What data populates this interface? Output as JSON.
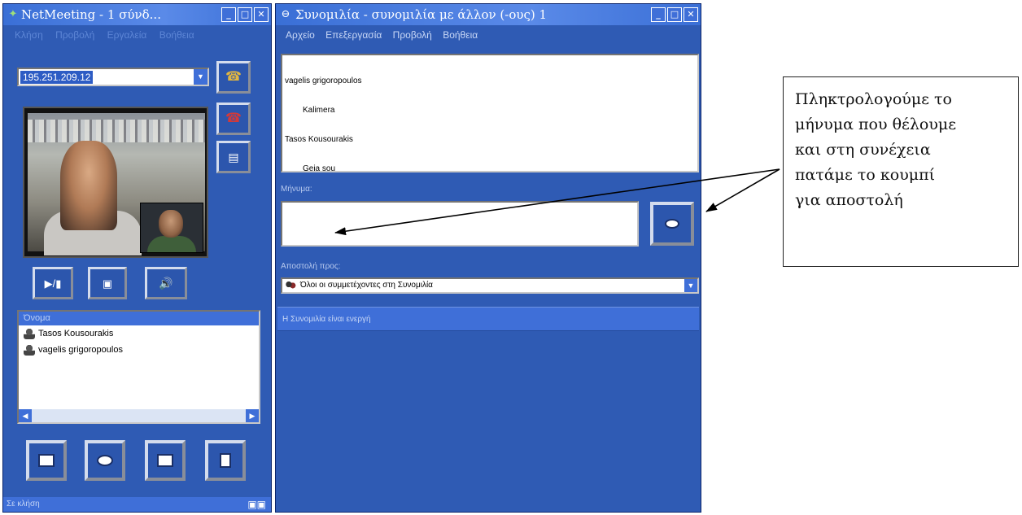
{
  "netmeeting": {
    "title": "NetMeeting - 1 σύνδ...",
    "menu": [
      "Κλήση",
      "Προβολή",
      "Εργαλεία",
      "Βοήθεια"
    ],
    "address_value": "195.251.209.12",
    "participants_header": "Όνομα",
    "participants": [
      "Tasos Kousourakis",
      "vagelis grigoropoulos"
    ],
    "status": "Σε κλήση"
  },
  "chat": {
    "title": "Συνομιλία - συνομιλία με άλλον (-ους) 1",
    "menu": [
      "Αρχείο",
      "Επεξεργασία",
      "Προβολή",
      "Βοήθεια"
    ],
    "log": [
      {
        "sender": "vagelis grigoropoulos",
        "message": "Kalimera"
      },
      {
        "sender": "Tasos Kousourakis",
        "message": "Geia sou"
      }
    ],
    "message_label": "Μήνυμα:",
    "message_value": "",
    "sendto_label": "Αποστολή προς:",
    "sendto_value": "Όλοι οι συμμετέχοντες στη Συνομιλία",
    "status": "Η Συνομιλία είναι ενεργή"
  },
  "annotation": {
    "lines": [
      "Πληκτρολογούμε το",
      "μήνυμα που θέλουμε",
      "και στη συνέχεια",
      "πατάμε το κουμπί",
      "για αποστολή"
    ]
  }
}
